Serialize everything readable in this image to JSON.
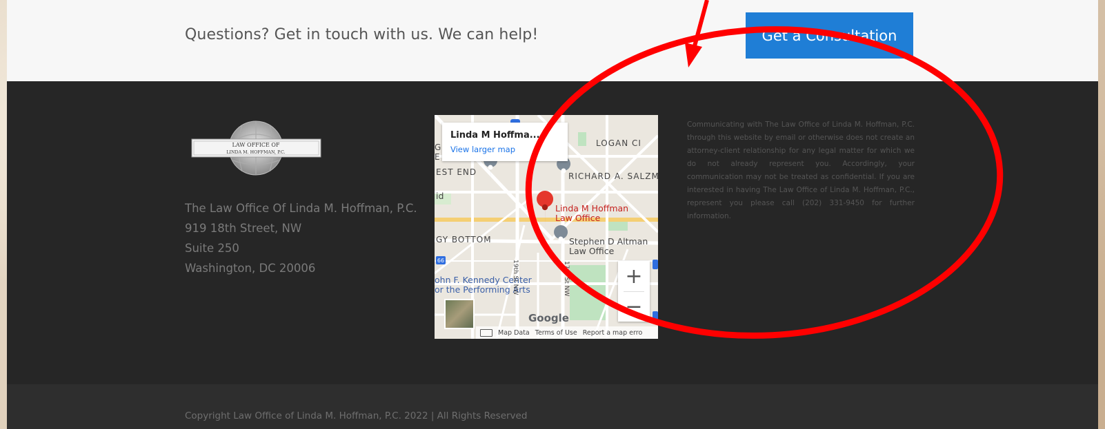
{
  "cta": {
    "text": "Questions? Get in touch with us. We can help!",
    "button_label": "Get a Consultation"
  },
  "logo": {
    "line1": "LAW OFFICE OF",
    "line2": "LINDA M. HOFFMAN, P.C."
  },
  "address": {
    "name": "The Law Office Of Linda M. Hoffman, P.C.",
    "street": "919 18th Street, NW",
    "suite": "Suite 250",
    "city": "Washington, DC 20006"
  },
  "map": {
    "card_title": "Linda M Hoffma...",
    "card_link": "View larger map",
    "labels": {
      "logan": "LOGAN CI",
      "west_end": "EST END",
      "richard": "RICHARD A. SALZM",
      "foggy_bottom": "GY BOTTOM",
      "hoffman_pin_1": "Linda M Hoffman",
      "hoffman_pin_2": "Law Office",
      "altman_1": "Stephen D Altman",
      "altman_2": "Law Office",
      "kennedy_1": "ohn F. Kennedy Center",
      "kennedy_2": "or the Performing Arts",
      "street_19": "19th St NW",
      "street_17": "17th St NW",
      "gr": "Gr",
      "e": "E",
      "id": "id",
      "route_66": "66"
    },
    "zoom_in": "+",
    "zoom_out": "−",
    "google": "Google",
    "footer": {
      "map_data": "Map Data",
      "terms": "Terms of Use",
      "report": "Report a map erro"
    }
  },
  "disclaimer": "Communicating with The Law Office of Linda M. Hoffman, P.C. through this website by email or otherwise does not create an attorney-client relationship for any legal matter for which we do not already represent you. Accordingly, your communication may not be treated as confidential. If you are interested in having The Law Office of Linda M. Hoffman, P.C., represent you please call (202) 331-9450 for further information.",
  "copyright": "Copyright Law Office of Linda M. Hoffman, P.C. 2022 | All Rights Reserved",
  "colors": {
    "cta_button": "#1f7ed6",
    "footer_bg": "#262626",
    "annotation": "#ff0000"
  }
}
